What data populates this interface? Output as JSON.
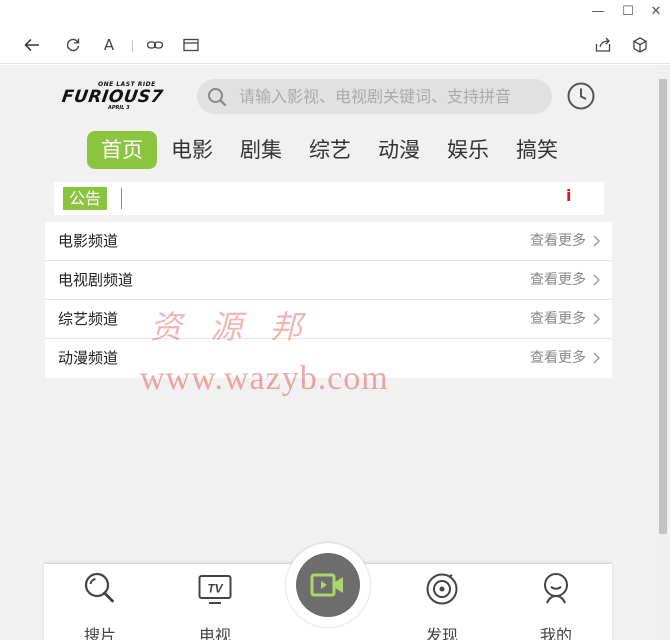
{
  "window": {
    "minimize_glyph": "—",
    "maximize_glyph": "☐",
    "close_glyph": "✕"
  },
  "toolbar": {
    "font_label": "A",
    "icons": [
      "back-arrow-icon",
      "refresh-icon",
      "font-icon",
      "link-icon",
      "reader-icon",
      "share-icon",
      "cube-icon"
    ]
  },
  "header": {
    "logo": {
      "top": "ONE LAST RIDE",
      "main": "FURIOUS7",
      "bottom": "APRIL 3"
    },
    "search_placeholder": "请输入影视、电视剧关键词、支持拼音"
  },
  "nav": {
    "items": [
      {
        "label": "首页",
        "active": true
      },
      {
        "label": "电影",
        "active": false
      },
      {
        "label": "剧集",
        "active": false
      },
      {
        "label": "综艺",
        "active": false
      },
      {
        "label": "动漫",
        "active": false
      },
      {
        "label": "娱乐",
        "active": false
      },
      {
        "label": "搞笑",
        "active": false
      }
    ]
  },
  "notice": {
    "badge": "公告",
    "mark": "i"
  },
  "channels": [
    {
      "title": "电影频道",
      "more": "查看更多"
    },
    {
      "title": "电视剧频道",
      "more": "查看更多"
    },
    {
      "title": "综艺频道",
      "more": "查看更多"
    },
    {
      "title": "动漫频道",
      "more": "查看更多"
    }
  ],
  "watermark": {
    "line1": "资源邦",
    "line2": "www.wazyb.com"
  },
  "bottom_tabs": [
    {
      "label": "搜片",
      "icon": "search-icon"
    },
    {
      "label": "电视",
      "icon": "tv-icon"
    },
    {
      "label": "发现",
      "icon": "discover-icon"
    },
    {
      "label": "我的",
      "icon": "user-icon"
    }
  ],
  "center_tab": {
    "icon": "video-camera-icon"
  },
  "tv_icon_text": "TV",
  "colors": {
    "accent": "#8bc53f",
    "notice_mark": "#e01818",
    "center_button": "#6d6d6d"
  }
}
